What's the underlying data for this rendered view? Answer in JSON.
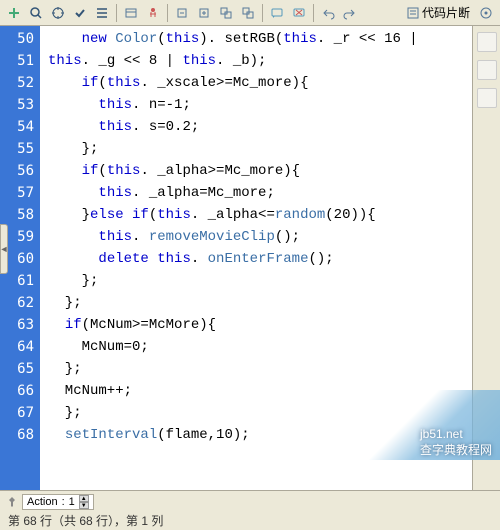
{
  "toolbar": {
    "snippet_label": "代码片断"
  },
  "gutter": {
    "start": 50,
    "end": 68
  },
  "code": {
    "lines": [
      [
        {
          "t": "    "
        },
        {
          "t": "new ",
          "c": "kw"
        },
        {
          "t": "Color",
          "c": "func"
        },
        {
          "t": "("
        },
        {
          "t": "this",
          "c": "kw"
        },
        {
          "t": "). setRGB("
        },
        {
          "t": "this",
          "c": "kw"
        },
        {
          "t": ". _r << 16 |"
        }
      ],
      [
        {
          "t": "this",
          "c": "kw"
        },
        {
          "t": ". _g << 8 | "
        },
        {
          "t": "this",
          "c": "kw"
        },
        {
          "t": ". _b);"
        }
      ],
      [
        {
          "t": "    "
        },
        {
          "t": "if",
          "c": "kw"
        },
        {
          "t": "("
        },
        {
          "t": "this",
          "c": "kw"
        },
        {
          "t": ". _xscale>=Mc_more){"
        }
      ],
      [
        {
          "t": "      "
        },
        {
          "t": "this",
          "c": "kw"
        },
        {
          "t": ". n=-1;"
        }
      ],
      [
        {
          "t": "      "
        },
        {
          "t": "this",
          "c": "kw"
        },
        {
          "t": ". s=0.2;"
        }
      ],
      [
        {
          "t": "    };"
        }
      ],
      [
        {
          "t": "    "
        },
        {
          "t": "if",
          "c": "kw"
        },
        {
          "t": "("
        },
        {
          "t": "this",
          "c": "kw"
        },
        {
          "t": ". _alpha>=Mc_more){"
        }
      ],
      [
        {
          "t": "      "
        },
        {
          "t": "this",
          "c": "kw"
        },
        {
          "t": ". _alpha=Mc_more;"
        }
      ],
      [
        {
          "t": "    }"
        },
        {
          "t": "else if",
          "c": "kw"
        },
        {
          "t": "("
        },
        {
          "t": "this",
          "c": "kw"
        },
        {
          "t": ". _alpha<="
        },
        {
          "t": "random",
          "c": "func"
        },
        {
          "t": "(20)){"
        }
      ],
      [
        {
          "t": "      "
        },
        {
          "t": "this",
          "c": "kw"
        },
        {
          "t": ". "
        },
        {
          "t": "removeMovieClip",
          "c": "func"
        },
        {
          "t": "();"
        }
      ],
      [
        {
          "t": "      "
        },
        {
          "t": "delete ",
          "c": "kw"
        },
        {
          "t": "this",
          "c": "kw"
        },
        {
          "t": ". "
        },
        {
          "t": "onEnterFrame",
          "c": "func"
        },
        {
          "t": "();"
        }
      ],
      [
        {
          "t": "    };"
        }
      ],
      [
        {
          "t": "  };"
        }
      ],
      [
        {
          "t": "  "
        },
        {
          "t": "if",
          "c": "kw"
        },
        {
          "t": "(McNum>=McMore){"
        }
      ],
      [
        {
          "t": "    McNum=0;"
        }
      ],
      [
        {
          "t": "  };"
        }
      ],
      [
        {
          "t": "  McNum++;"
        }
      ],
      [
        {
          "t": "  };"
        }
      ],
      [
        {
          "t": "  "
        },
        {
          "t": "setInterval",
          "c": "func"
        },
        {
          "t": "(flame,10);"
        }
      ],
      [
        {
          "t": ""
        }
      ]
    ]
  },
  "bottom": {
    "actions_label": "Action",
    "actions_value": "1"
  },
  "status": {
    "text": "第 68 行（共 68 行），第 1 列"
  },
  "watermark": {
    "site": "jb51.net",
    "text": "查字典教程网"
  }
}
